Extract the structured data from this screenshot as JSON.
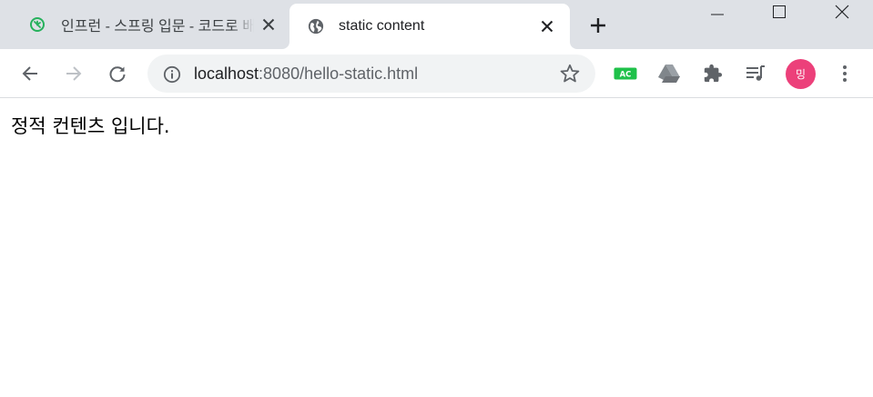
{
  "tabs": [
    {
      "title": "인프런 - 스프링 입문 - 코드로 배우는 스프링 부트",
      "favicon": "inflearn-icon",
      "active": false
    },
    {
      "title": "static content",
      "favicon": "globe-icon",
      "active": true
    }
  ],
  "address_bar": {
    "host": "localhost",
    "rest": ":8080/hello-static.html"
  },
  "extensions": {
    "ac_badge": "AC"
  },
  "profile": {
    "avatar_text": "밍"
  },
  "page": {
    "body_text": "정적 컨텐츠 입니다."
  },
  "colors": {
    "tab_strip": "#dee1e6",
    "omnibox": "#f1f3f4",
    "inflearn_green": "#26b15c",
    "ac_badge_green": "#1fc14a",
    "avatar_pink": "#ec407a"
  }
}
